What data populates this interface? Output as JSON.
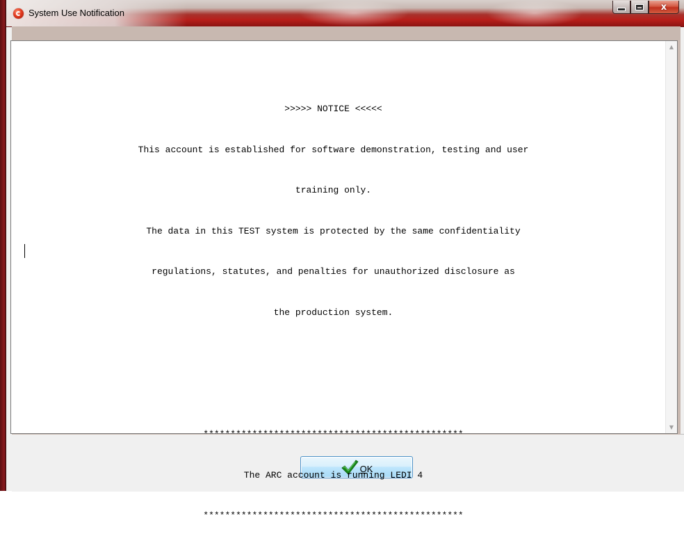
{
  "window": {
    "title": "System Use Notification",
    "controls": {
      "minimize_icon": "minimize-icon",
      "maximize_icon": "maximize-icon",
      "close_glyph": "x"
    },
    "accent_color": "#b81e1a"
  },
  "notice": {
    "lines": [
      ">>>>> NOTICE <<<<<",
      "This account is established for software demonstration, testing and user",
      "training only.",
      "The data in this TEST system is protected by the same confidentiality",
      "regulations, statutes, and penalties for unauthorized disclosure as",
      "the production system.",
      "",
      "",
      "************************************************",
      "The ARC account is running LEDI 4",
      "************************************************"
    ]
  },
  "footer": {
    "ok_button": {
      "mnemonic": "O",
      "rest": "K",
      "icon": "checkmark-icon",
      "icon_color": "#1a8a1a"
    }
  }
}
